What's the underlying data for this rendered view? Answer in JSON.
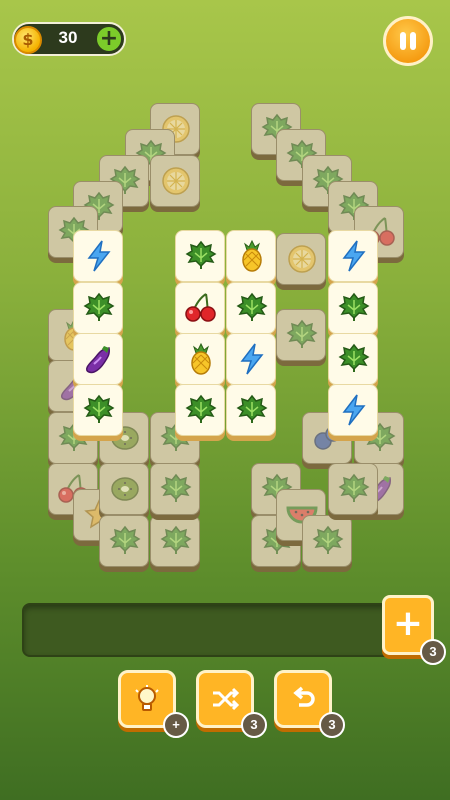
{
  "header": {
    "coins": "30",
    "coin_symbol": "$",
    "add_coins_label": "+",
    "pause_label": "pause"
  },
  "board": {
    "tiles": [
      {
        "kind": "lemon",
        "layer": "dim"
      },
      {
        "kind": "leaf",
        "layer": "dim"
      },
      {
        "kind": "leaf",
        "layer": "dim"
      },
      {
        "kind": "leaf",
        "layer": "dim"
      },
      {
        "kind": "leaf",
        "layer": "dim"
      },
      {
        "kind": "leaf",
        "layer": "dim"
      },
      {
        "kind": "leaf",
        "layer": "dim"
      },
      {
        "kind": "leaf",
        "layer": "dim"
      },
      {
        "kind": "leaf",
        "layer": "dim"
      },
      {
        "kind": "cherry",
        "layer": "dim"
      },
      {
        "kind": "lemon",
        "layer": "dim"
      },
      {
        "kind": "lemon",
        "layer": "dim"
      },
      {
        "kind": "pineapple",
        "layer": "dim"
      },
      {
        "kind": "leaf",
        "layer": "dim"
      },
      {
        "kind": "eggplant",
        "layer": "dim"
      },
      {
        "kind": "blueberry",
        "layer": "dim"
      },
      {
        "kind": "leaf",
        "layer": "dim"
      },
      {
        "kind": "leaf",
        "layer": "dim"
      },
      {
        "kind": "cherry",
        "layer": "dim"
      },
      {
        "kind": "eggplant",
        "layer": "dim"
      },
      {
        "kind": "star",
        "layer": "dim"
      },
      {
        "kind": "kiwi",
        "layer": "dim"
      },
      {
        "kind": "kiwi",
        "layer": "dim"
      },
      {
        "kind": "leaf",
        "layer": "dim"
      },
      {
        "kind": "leaf",
        "layer": "dim"
      },
      {
        "kind": "leaf",
        "layer": "dim"
      },
      {
        "kind": "leaf",
        "layer": "dim"
      },
      {
        "kind": "leaf",
        "layer": "dim"
      },
      {
        "kind": "watermelon",
        "layer": "dim"
      },
      {
        "kind": "leaf",
        "layer": "dim"
      },
      {
        "kind": "leaf",
        "layer": "dim"
      },
      {
        "kind": "leaf",
        "layer": "dim"
      },
      {
        "kind": "bolt",
        "layer": "hi"
      },
      {
        "kind": "leaf",
        "layer": "hi"
      },
      {
        "kind": "eggplant",
        "layer": "hi"
      },
      {
        "kind": "leaf",
        "layer": "hi"
      },
      {
        "kind": "leaf",
        "layer": "hi"
      },
      {
        "kind": "cherry",
        "layer": "hi"
      },
      {
        "kind": "pineapple",
        "layer": "hi"
      },
      {
        "kind": "leaf",
        "layer": "hi"
      },
      {
        "kind": "pineapple",
        "layer": "hi"
      },
      {
        "kind": "leaf",
        "layer": "hi"
      },
      {
        "kind": "bolt",
        "layer": "hi"
      },
      {
        "kind": "leaf",
        "layer": "hi"
      },
      {
        "kind": "bolt",
        "layer": "hi"
      },
      {
        "kind": "leaf",
        "layer": "hi"
      },
      {
        "kind": "leaf",
        "layer": "hi"
      },
      {
        "kind": "bolt",
        "layer": "hi"
      }
    ]
  },
  "tray": {
    "add_slot_label": "+",
    "add_slot_count": "3"
  },
  "powerups": [
    {
      "name": "hint",
      "icon": "lightbulb-icon",
      "badge": "+"
    },
    {
      "name": "shuffle",
      "icon": "shuffle-icon",
      "badge": "3"
    },
    {
      "name": "undo",
      "icon": "undo-icon",
      "badge": "3"
    }
  ]
}
